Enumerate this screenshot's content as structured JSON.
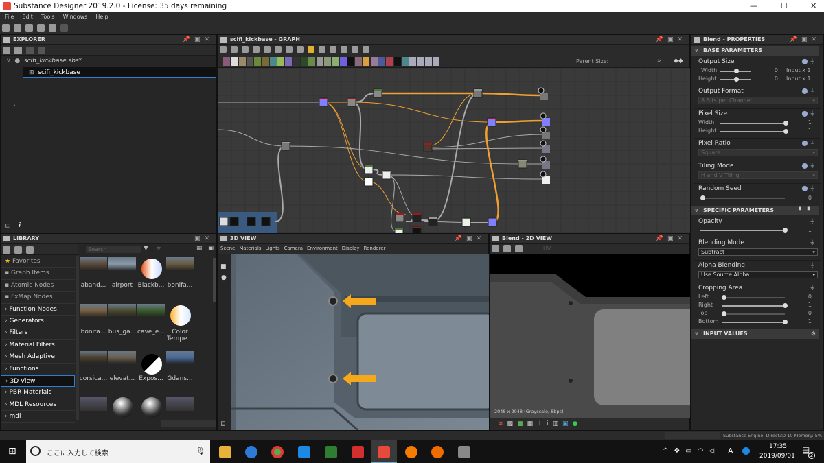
{
  "window": {
    "title": "Substance Designer 2019.2.0 - License: 35 days remaining",
    "minimize": "—",
    "maximize": "☐",
    "close": "✕"
  },
  "menu": [
    "File",
    "Edit",
    "Tools",
    "Windows",
    "Help"
  ],
  "explorer": {
    "title": "EXPLORER",
    "package": "scifi_kickbase.sbs*",
    "graph": "scifi_kickbase"
  },
  "library": {
    "title": "LIBRARY",
    "search_placeholder": "Search",
    "categories": [
      {
        "label": "Favorites",
        "icon": "star-icon"
      },
      {
        "label": "Graph Items",
        "icon": "comment-icon"
      },
      {
        "label": "Atomic Nodes",
        "icon": "nodes-icon"
      },
      {
        "label": "FxMap Nodes",
        "icon": "grid-icon"
      },
      {
        "label": "Function Nodes"
      },
      {
        "label": "Generators"
      },
      {
        "label": "Filters"
      },
      {
        "label": "Material Filters"
      },
      {
        "label": "Mesh Adaptive"
      },
      {
        "label": "Functions"
      },
      {
        "label": "3D View",
        "selected": true
      },
      {
        "label": "PBR Materials"
      },
      {
        "label": "MDL Resources"
      },
      {
        "label": "mdl"
      }
    ],
    "items": [
      "aband...",
      "airport",
      "Blackb...",
      "bonifa...",
      "bonifa...",
      "bus_ga...",
      "cave_e...",
      "Color Tempe...",
      "corsica...",
      "elevat...",
      "Expos...",
      "Gdans..."
    ]
  },
  "graph": {
    "title": "scifi_kickbase - GRAPH",
    "parent_size_label": "Parent Size:",
    "more": "»"
  },
  "view3d": {
    "title": "3D VIEW",
    "menu": [
      "Scene",
      "Materials",
      "Lights",
      "Camera",
      "Environment",
      "Display",
      "Renderer"
    ]
  },
  "view2d": {
    "title": "Blend - 2D VIEW",
    "uv": "UV",
    "info": "2048 x 2048 (Grayscale, 8bpc)"
  },
  "properties": {
    "title": "Blend - PROPERTIES",
    "base_section": "BASE PARAMETERS",
    "output_size": {
      "label": "Output Size",
      "width_label": "Width",
      "width_value": "0",
      "width_suffix": "Input x 1",
      "height_label": "Height",
      "height_value": "0",
      "height_suffix": "Input x 1"
    },
    "output_format": {
      "label": "Output Format",
      "value": "8 Bits per Channel"
    },
    "pixel_size": {
      "label": "Pixel Size",
      "width_label": "Width",
      "width_value": "1",
      "height_label": "Height",
      "height_value": "1"
    },
    "pixel_ratio": {
      "label": "Pixel Ratio",
      "value": "Square"
    },
    "tiling_mode": {
      "label": "Tiling Mode",
      "value": "H and V Tiling"
    },
    "random_seed": {
      "label": "Random Seed",
      "value": "0"
    },
    "specific_section": "SPECIFIC PARAMETERS",
    "opacity": {
      "label": "Opacity",
      "value": "1"
    },
    "blending_mode": {
      "label": "Blending Mode",
      "value": "Subtract"
    },
    "alpha_blending": {
      "label": "Alpha Blending",
      "value": "Use Source Alpha"
    },
    "cropping": {
      "label": "Cropping Area",
      "left_label": "Left",
      "left": "0",
      "right_label": "Right",
      "right": "1",
      "top_label": "Top",
      "top": "0",
      "bottom_label": "Bottom",
      "bottom": "1"
    },
    "input_section": "INPUT VALUES"
  },
  "status": {
    "engine": "Substance Engine: Direct3D 10  Memory: 5%"
  },
  "taskbar": {
    "search_placeholder": "ここに入力して検索",
    "time": "17:35",
    "date": "2019/09/01",
    "ime": "A",
    "notifications": "2"
  },
  "colors": {
    "accent": "#2f7fd0",
    "orange_link": "#f0a030",
    "node_blue": "#8080ff",
    "node_red": "#a01818"
  }
}
